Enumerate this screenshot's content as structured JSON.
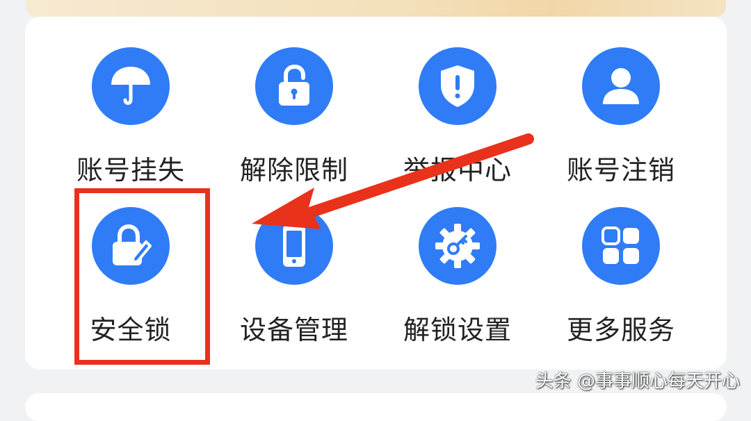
{
  "colors": {
    "accent": "#2f7cf6",
    "highlight": "#e8321c",
    "label": "#222222"
  },
  "services": [
    {
      "label": "账号挂失",
      "icon": "umbrella-icon"
    },
    {
      "label": "解除限制",
      "icon": "unlock-icon"
    },
    {
      "label": "举报中心",
      "icon": "shield-alert-icon"
    },
    {
      "label": "账号注销",
      "icon": "user-icon"
    },
    {
      "label": "安全锁",
      "icon": "lock-edit-icon"
    },
    {
      "label": "设备管理",
      "icon": "phone-icon"
    },
    {
      "label": "解锁设置",
      "icon": "gear-key-icon"
    },
    {
      "label": "更多服务",
      "icon": "grid-icon"
    }
  ],
  "watermark": "头条 @事事顺心每天开心"
}
